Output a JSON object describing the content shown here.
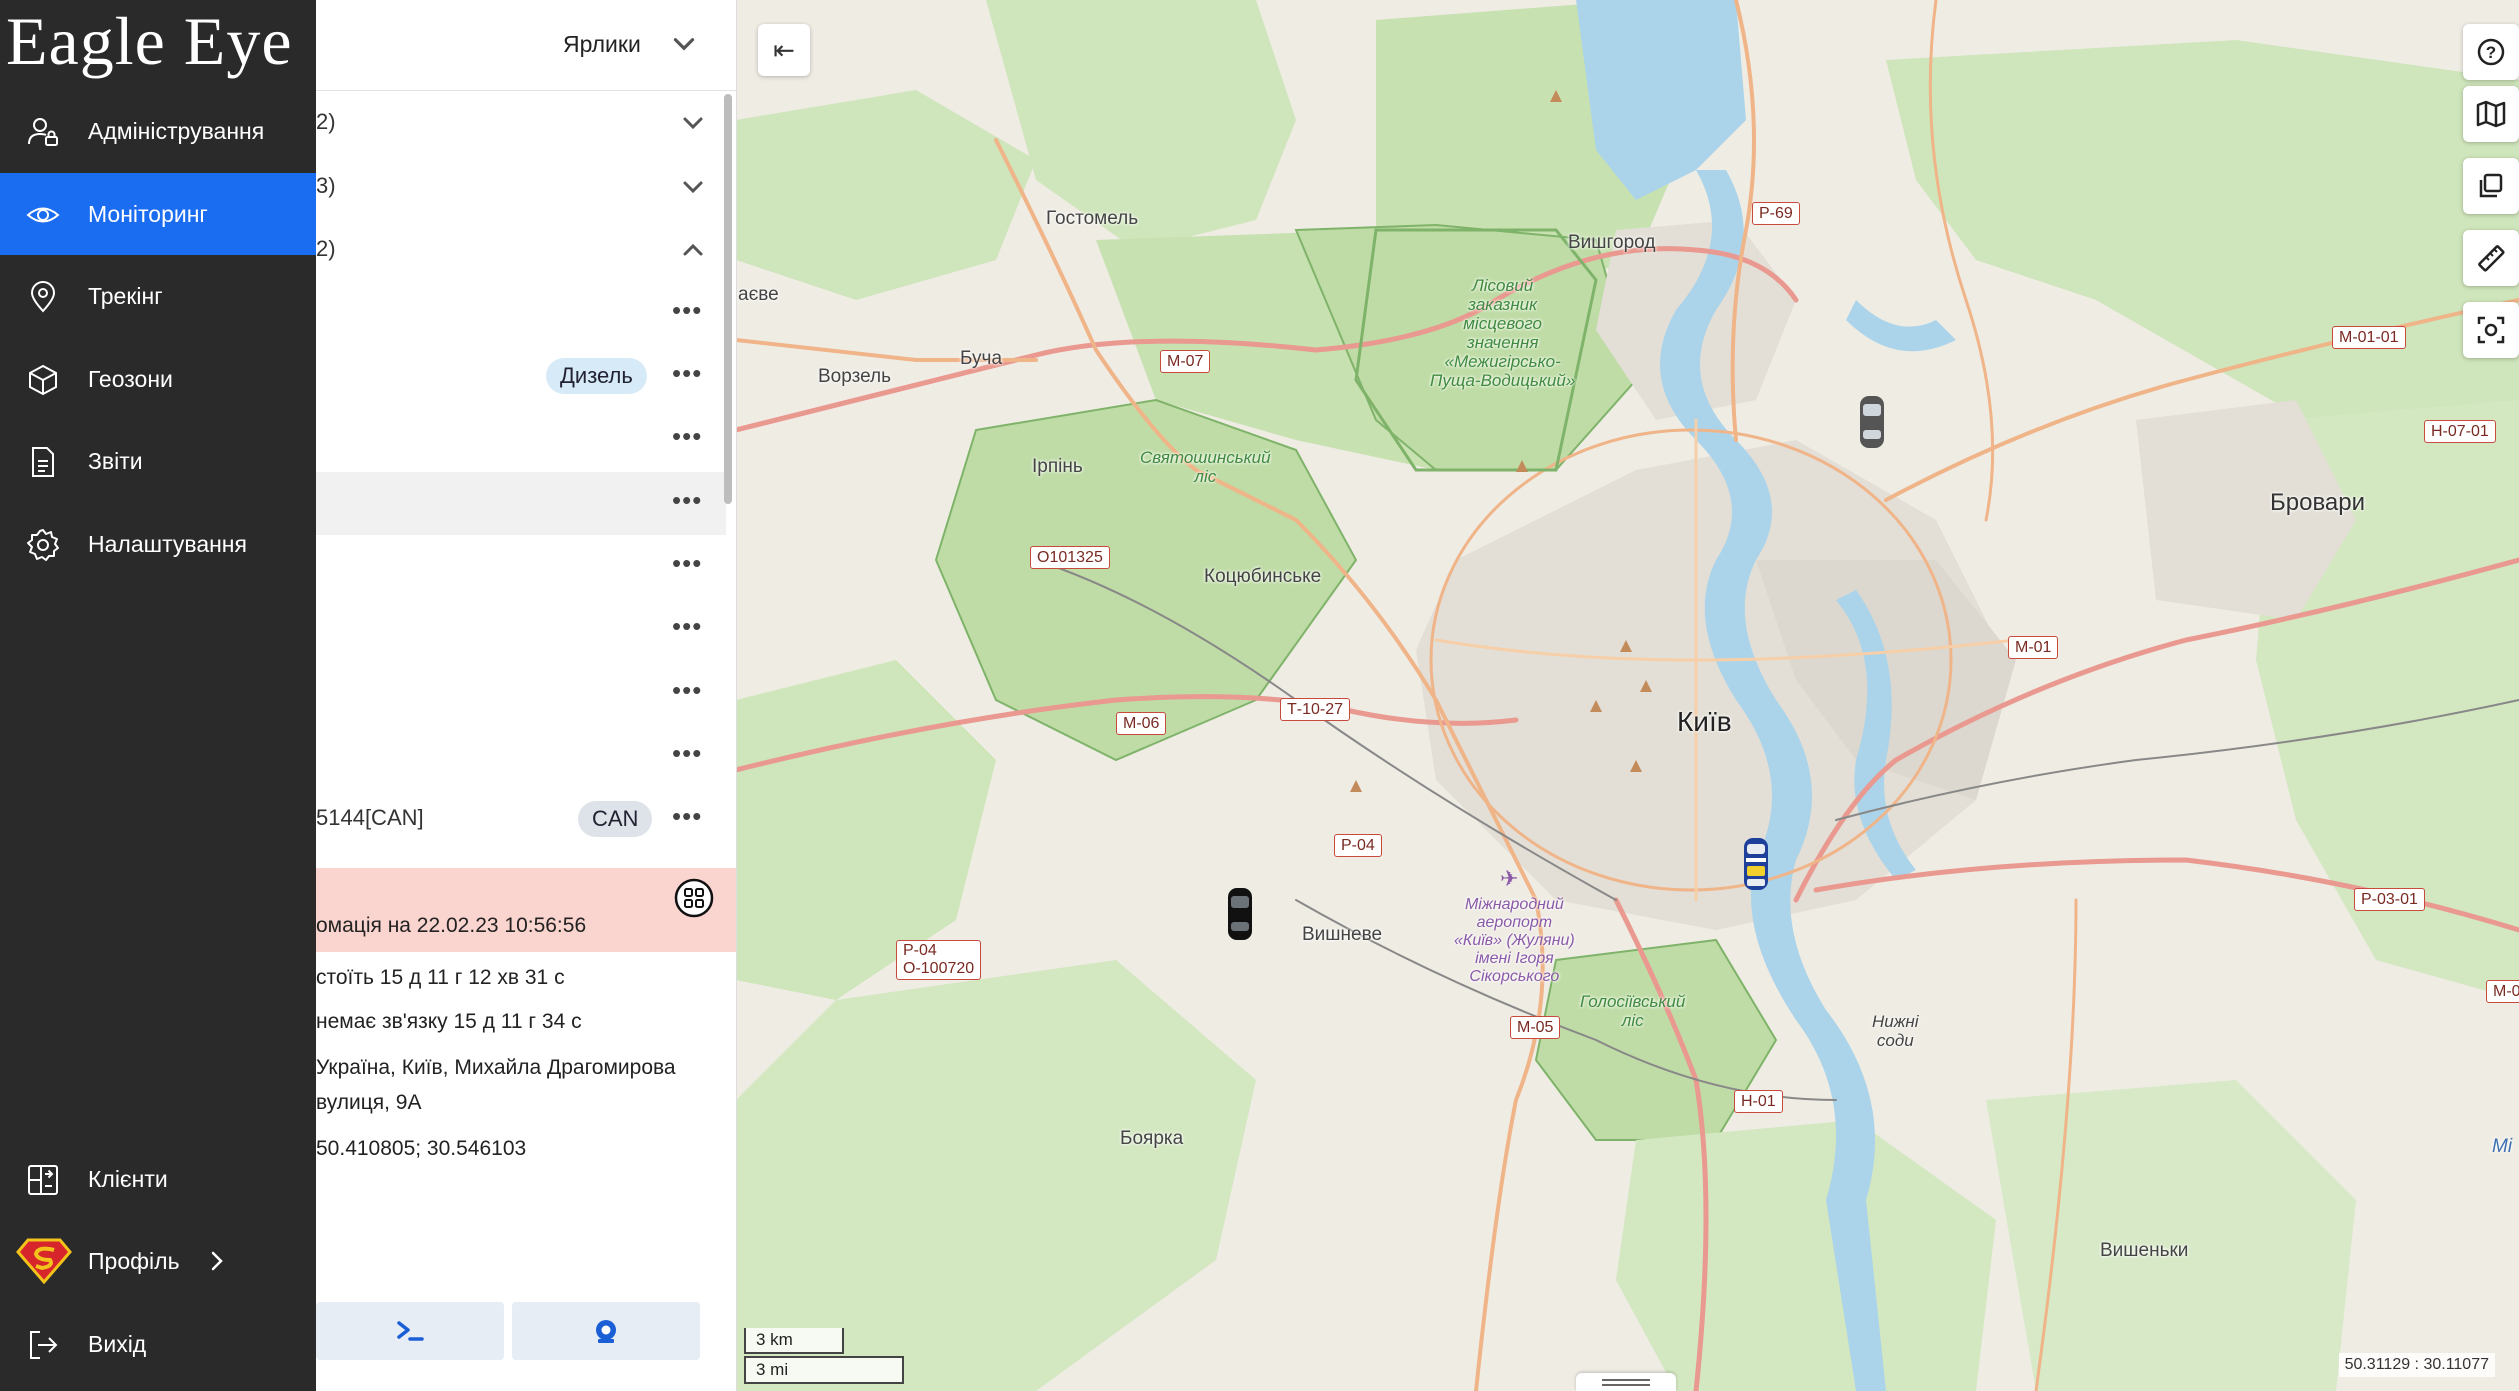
{
  "app": {
    "logo": "Eagle Eye"
  },
  "sidebar": {
    "items": [
      {
        "label": "Адміністрування",
        "icon": "user-lock-icon"
      },
      {
        "label": "Моніторинг",
        "icon": "eye-icon",
        "active": true
      },
      {
        "label": "Трекінг",
        "icon": "map-pin-icon"
      },
      {
        "label": "Геозони",
        "icon": "geozone-icon"
      },
      {
        "label": "Звіти",
        "icon": "report-document-icon"
      },
      {
        "label": "Налаштування",
        "icon": "gear-icon"
      }
    ],
    "bottom": [
      {
        "label": "Клієнти",
        "icon": "clients-icon"
      },
      {
        "label": "Профіль",
        "icon": "superman-avatar-icon"
      },
      {
        "label": "Вихід",
        "icon": "logout-icon"
      }
    ]
  },
  "panel": {
    "shortcuts_label": "Ярлики",
    "groups": [
      {
        "text": "2)"
      },
      {
        "text": "3)"
      },
      {
        "text": "2)"
      }
    ],
    "badges": {
      "diesel": "Дизель",
      "can": "CAN"
    },
    "object_name": "5144[CAN]",
    "more_glyph": "•••",
    "info": {
      "header": "омація на 22.02.23 10:56:56",
      "stands": "стоїть 15 д 11 г 12 хв 31 с",
      "no_connection": "немає зв'язку 15 д 11 г 34 с",
      "address_line1": "Україна, Київ, Михайла Драгомирова",
      "address_line2": "вулиця, 9А",
      "coords": "50.410805; 30.546103"
    },
    "buttons": [
      {
        "icon": "terminal-icon"
      },
      {
        "icon": "locate-icon"
      }
    ]
  },
  "map": {
    "collapse_glyph": "⇤",
    "labels": {
      "kyiv": "Київ",
      "brovary": "Бровари",
      "vyshhorod": "Вишгород",
      "hostomel": "Гостомель",
      "bucha": "Буча",
      "vorzel": "Ворзель",
      "irpin": "Ірпінь",
      "kotsiubynske": "Коцюбинське",
      "vyshneve": "Вишневе",
      "boiarka": "Боярка",
      "vyshenky": "Вишеньки",
      "ave": "аєве",
      "sviatoshynskyi": "Святошинський\nліс",
      "holosiivskyi": "Голосіївський\nліс",
      "nyzhni_sody": "Нижні\nсоди",
      "forest_reserve": "Лісовий\nзаказник\nмісцевого\nзначення\n«Межигірсько-\nПуща-Водицький»",
      "airport": "Міжнародний\nаеропорт\n«Київ» (Жуляни)\nімені Ігоря\nСікорського",
      "edge_label": "Мі"
    },
    "shields": {
      "p69": "Р-69",
      "m07": "М-07",
      "o101325": "О101325",
      "m06": "М-06",
      "t1027": "Т-10-27",
      "p04": "Р-04",
      "p04b": "Р-04\nО-100720",
      "m05": "М-05",
      "h01": "Н-01",
      "m01": "М-01",
      "m0101": "М-01-01",
      "h0701": "Н-07-01",
      "p0301": "Р-03-01",
      "m0edge": "М-0"
    },
    "scale": {
      "km": "3 km",
      "mi": "3 mi"
    },
    "cursor_coords": "50.31129 : 30.11077",
    "tools": [
      "help-icon",
      "map-layers-icon",
      "copy-layers-icon",
      "ruler-icon",
      "screenshot-icon"
    ],
    "colors": {
      "forest": "#c9e2b4",
      "water": "#a9d3e8",
      "urban": "#e0ddd5",
      "road_primary": "#f2b98e",
      "road_motorway": "#e8928a"
    }
  }
}
